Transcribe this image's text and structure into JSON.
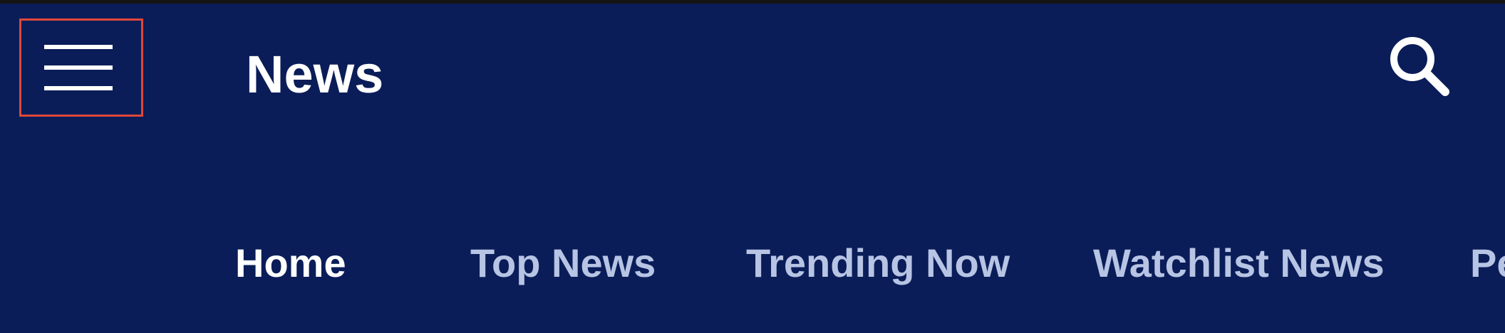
{
  "app_bar": {
    "title": "News",
    "background": "#0a1d58",
    "menu_button": {
      "icon": "hamburger-menu-icon",
      "highlighted": true,
      "highlight_color": "#e0473a"
    },
    "search_button": {
      "icon": "search-icon"
    }
  },
  "tabs": [
    {
      "label": "Home",
      "active": true
    },
    {
      "label": "Top News",
      "active": false
    },
    {
      "label": "Trending Now",
      "active": false
    },
    {
      "label": "Watchlist News",
      "active": false
    },
    {
      "label": "Pe",
      "active": false
    }
  ],
  "colors": {
    "active_tab": "#ffffff",
    "inactive_tab": "#b7c4e4",
    "title": "#ffffff"
  }
}
